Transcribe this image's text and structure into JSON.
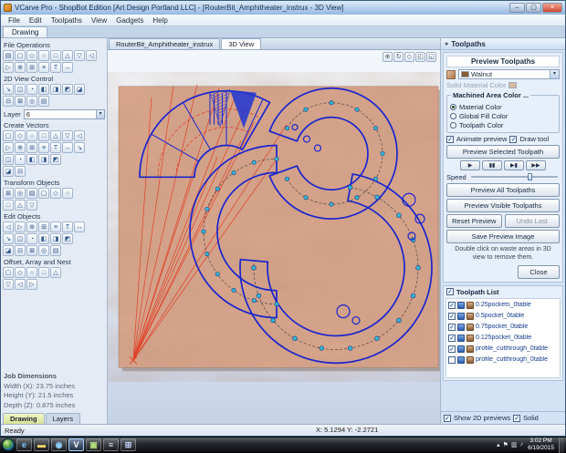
{
  "window": {
    "title": "VCarve Pro - ShopBot Edition [Art Design Portland LLC] - [RouterBit_Amphitheater_instrux - 3D View]",
    "controls": {
      "minimize": "–",
      "maximize": "▢",
      "close": "×"
    }
  },
  "menubar": {
    "items": [
      "File",
      "Edit",
      "Toolpaths",
      "View",
      "Gadgets",
      "Help"
    ]
  },
  "mode_tab": "Drawing",
  "left_panel": {
    "sections": [
      {
        "label": "File Operations",
        "rows": [
          [
            "new-file",
            "open-file",
            "save-file",
            "import-vectors",
            "export-vectors",
            "print",
            "cut",
            "copy"
          ],
          [
            "paste",
            "undo",
            "redo",
            "job-setup",
            "notes",
            "help"
          ]
        ]
      },
      {
        "label": "2D View Control",
        "rows": [
          [
            "zoom-in",
            "zoom-out",
            "zoom-window",
            "zoom-extents",
            "pan-view",
            "previous-view",
            "refresh"
          ],
          [
            "toggle-grid",
            "snap-grid",
            "rulers",
            "guides"
          ]
        ]
      },
      {
        "label": "Layer",
        "dropdown_value": "6"
      },
      {
        "label": "Create Vectors",
        "rows": [
          [
            "circle",
            "ellipse",
            "rectangle",
            "polygon",
            "star",
            "polyline",
            "arc"
          ],
          [
            "curve",
            "freehand",
            "vector-texture",
            "dimension",
            "node-edit",
            "measure",
            "trim"
          ],
          [
            "draw-text",
            "text-block",
            "auto-layout-text",
            "text-on-curve",
            "text-spacing"
          ],
          [
            "import-bitmap",
            "trace-bitmap"
          ]
        ]
      },
      {
        "label": "Transform Objects",
        "rows": [
          [
            "move",
            "rotate",
            "scale",
            "mirror",
            "distort",
            "align"
          ],
          [
            "group",
            "ungroup",
            "array-copy"
          ]
        ]
      },
      {
        "label": "Edit Objects",
        "rows": [
          [
            "select",
            "node-editing",
            "measure-tool",
            "join-vectors",
            "close-vector",
            "fillet",
            "extend"
          ],
          [
            "weld",
            "subtract",
            "intersect",
            "slice",
            "fit-curves",
            "trim-vectors"
          ],
          [
            "offset-vectors",
            "create-fillets",
            "scissors",
            "eraser",
            "snap"
          ]
        ]
      },
      {
        "label": "Offset, Array and Nest",
        "rows": [
          [
            "offset",
            "array",
            "copy-along-vector",
            "nest-parts",
            "symmetry"
          ],
          [
            "paste-along",
            "block-array",
            "circular-array"
          ]
        ]
      }
    ],
    "job_dimensions": {
      "title": "Job Dimensions",
      "lines": [
        "Width (X): 23.75 inches",
        "Height (Y): 21.5 inches",
        "Depth (Z): 0.875 inches"
      ]
    },
    "bottom_tabs": [
      {
        "label": "Drawing",
        "active": true
      },
      {
        "label": "Layers",
        "active": false
      }
    ]
  },
  "canvas": {
    "tabs": [
      {
        "label": "RouterBit_Amphitheater_instrux",
        "active": false
      },
      {
        "label": "3D View",
        "active": true
      }
    ],
    "view_toolbar": [
      "zoom-extents",
      "rotate-view",
      "iso-view",
      "top-view",
      "front-view"
    ]
  },
  "toolpaths_panel": {
    "title": "Toolpaths",
    "preview": {
      "title": "Preview Toolpaths",
      "material_value": "Walnut",
      "solid_material_color_label": "Solid Material Color",
      "machined_area_group": {
        "label": "Machined Area Color ...",
        "options": [
          {
            "label": "Material Color",
            "selected": true
          },
          {
            "label": "Global Fill Color",
            "selected": false
          },
          {
            "label": "Toolpath Color",
            "selected": false
          }
        ]
      },
      "animate_preview_label": "Animate preview",
      "draw_tool_label": "Draw tool",
      "preview_selected_button": "Preview Selected Toolpath",
      "playback": [
        {
          "name": "play",
          "glyph": "▶"
        },
        {
          "name": "pause",
          "glyph": "▮▮"
        },
        {
          "name": "single-step",
          "glyph": "▶▮"
        },
        {
          "name": "run-to-end",
          "glyph": "▶▶"
        }
      ],
      "speed_label": "Speed",
      "preview_all_button": "Preview All Toolpaths",
      "preview_visible_button": "Preview Visible Toolpaths",
      "reset_button": "Reset Preview",
      "undo_button": "Undo Last",
      "save_button": "Save Preview Image",
      "note": "Double click on waste areas in 3D view to remove them.",
      "close_button": "Close"
    },
    "toolpath_list": {
      "title": "Toolpath List",
      "items": [
        {
          "checked": true,
          "name": "0.25pockets_0table"
        },
        {
          "checked": true,
          "name": "0.5pocket_0table"
        },
        {
          "checked": true,
          "name": "0.75pocket_0table"
        },
        {
          "checked": true,
          "name": "0.125pocket_0table"
        },
        {
          "checked": true,
          "name": "profile_cutthrough_0table"
        },
        {
          "checked": false,
          "name": "profile_cutthrough_0table"
        }
      ]
    },
    "footer": {
      "show_2d_label": "Show 2D previews",
      "show_2d_checked": true,
      "solid_label": "Solid",
      "solid_checked": true
    }
  },
  "status_bar": {
    "ready": "Ready",
    "coordinates": "X: 5.1294 Y: -2.2721"
  },
  "taskbar": {
    "start_button": "start",
    "icons": [
      {
        "name": "internet-explorer",
        "glyph": "e",
        "color": "#7fc4ff"
      },
      {
        "name": "windows-explorer",
        "glyph": "▬",
        "color": "#ffd76e"
      },
      {
        "name": "media-player",
        "glyph": "◉",
        "color": "#8fd3ff"
      },
      {
        "name": "vcarve-pro",
        "glyph": "V",
        "color": "#ffffff",
        "active": true
      },
      {
        "name": "image-viewer",
        "glyph": "▣",
        "color": "#b7e07e"
      },
      {
        "name": "notepad",
        "glyph": "≡",
        "color": "#dce6f2"
      },
      {
        "name": "calculator",
        "glyph": "⊞",
        "color": "#c9d4ff"
      }
    ],
    "tray_icons": [
      "hidden-icons",
      "action-center",
      "network",
      "volume"
    ],
    "clock_time": "3:02 PM",
    "clock_date": "6/19/2015"
  },
  "colors": {
    "wood": "#d9a68d",
    "vector_blue": "#1b25cd",
    "toolpath_red": "#e23b22",
    "dot_teal": "#37b6cf"
  }
}
